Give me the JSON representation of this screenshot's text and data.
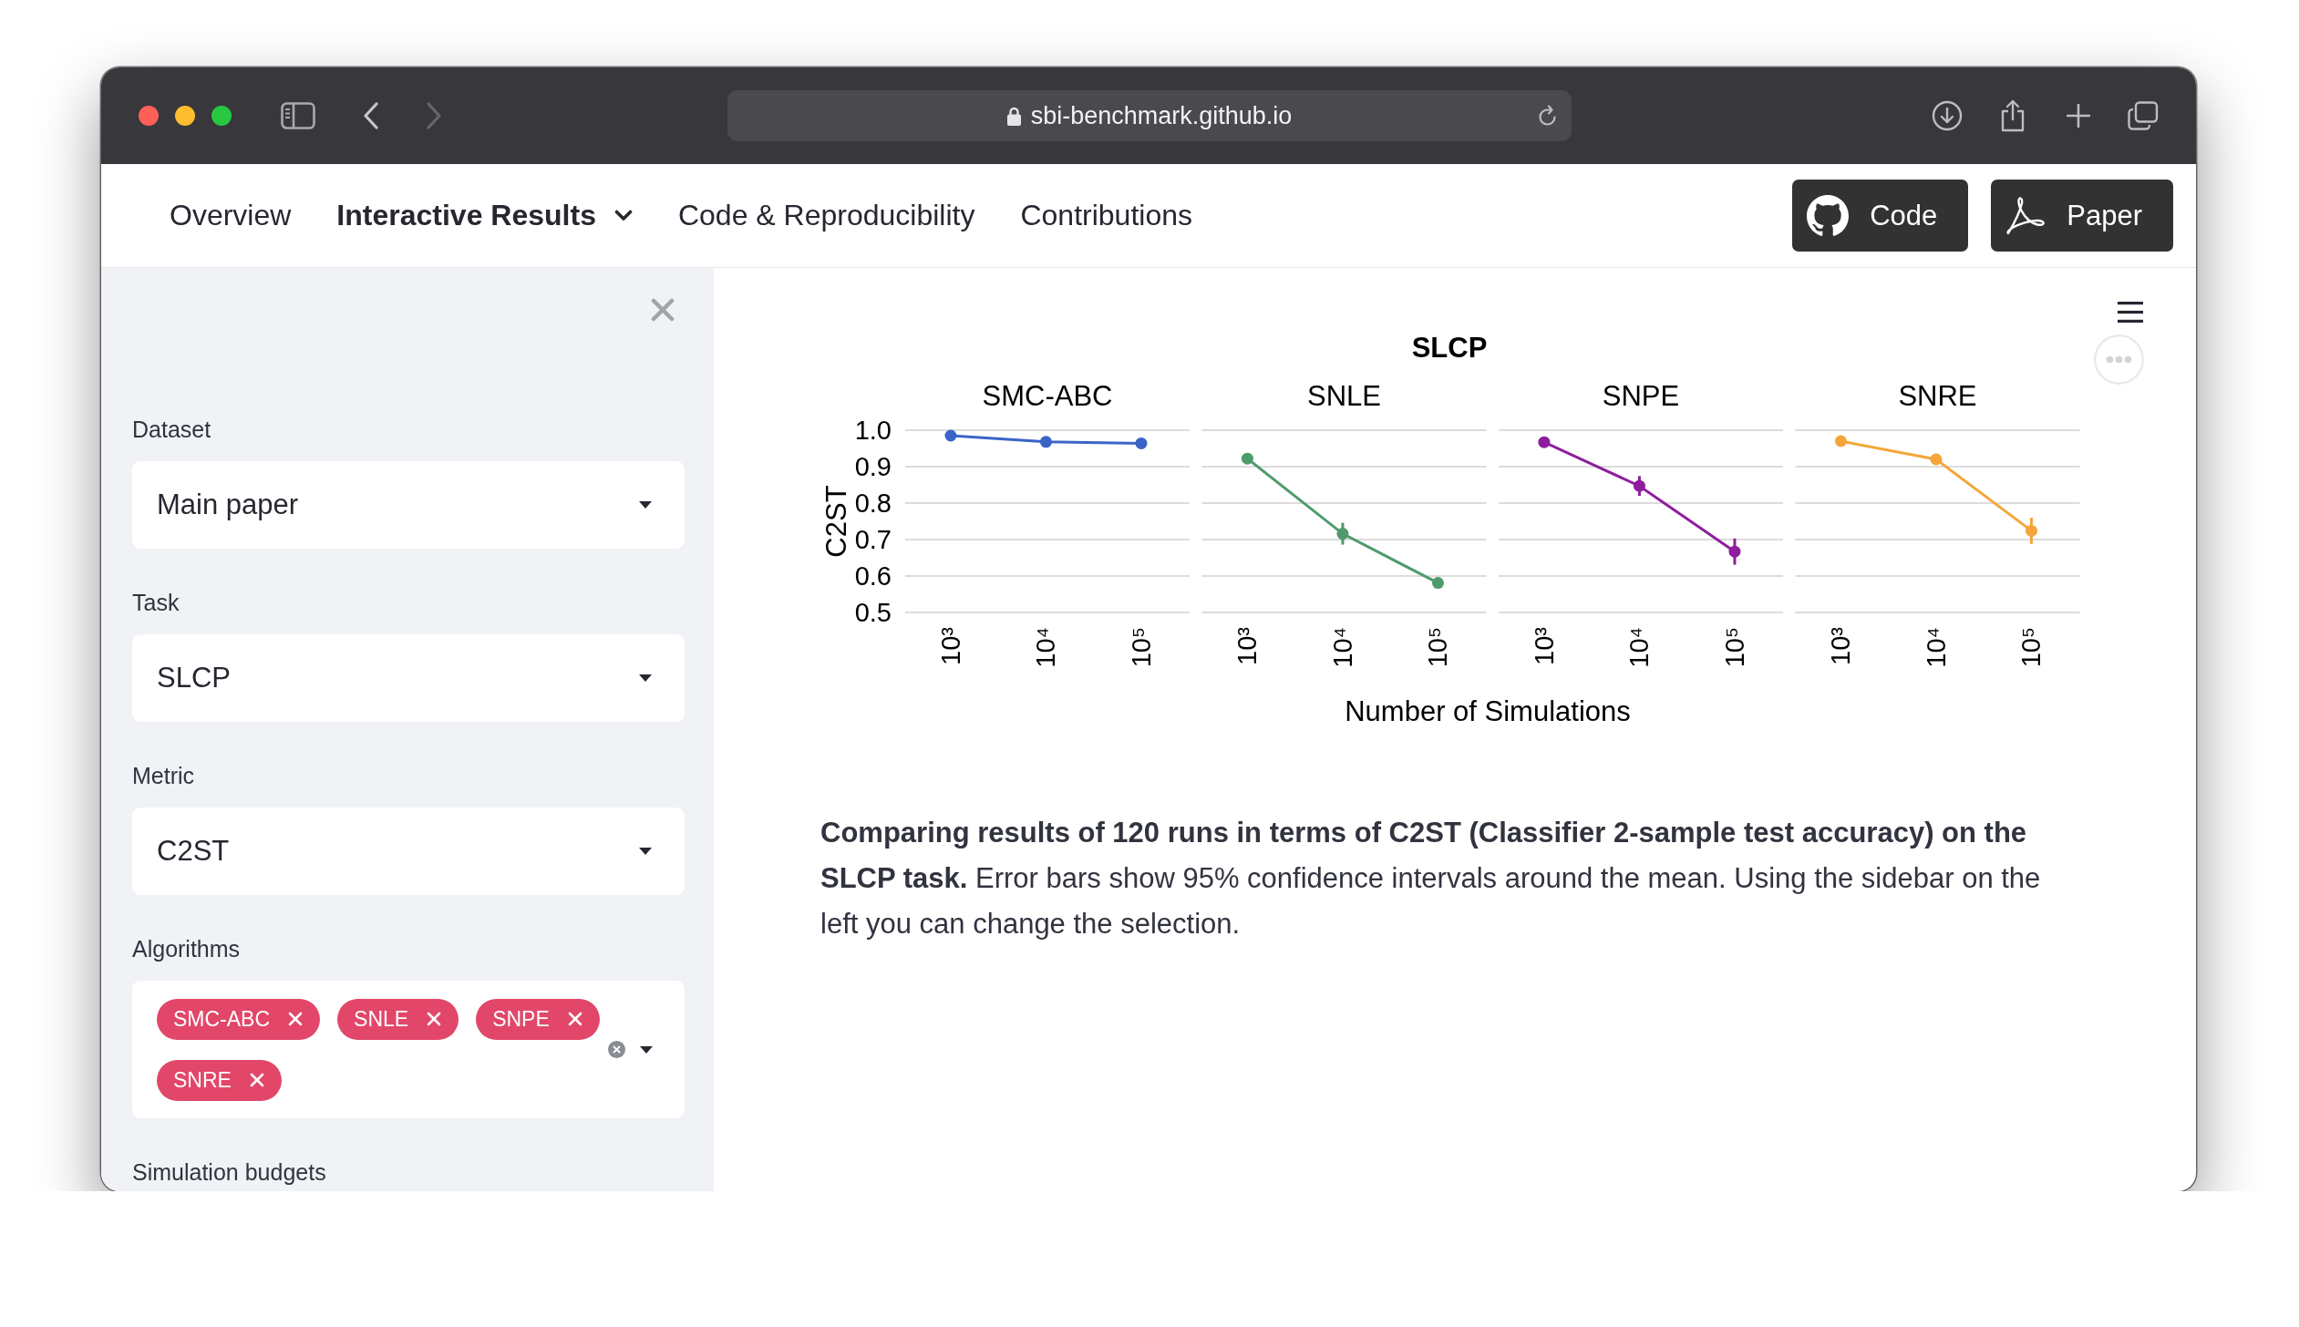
{
  "browser": {
    "url": "sbi-benchmark.github.io",
    "back_disabled": false,
    "forward_disabled": true
  },
  "nav": {
    "items": [
      {
        "label": "Overview",
        "kind": "link",
        "selected": false
      },
      {
        "label": "Interactive Results",
        "kind": "dropdown",
        "selected": true
      },
      {
        "label": "Code & Reproducibility",
        "kind": "link",
        "selected": false
      },
      {
        "label": "Contributions",
        "kind": "link",
        "selected": false
      }
    ],
    "buttons": [
      {
        "label": "Code",
        "kind": "github"
      },
      {
        "label": "Paper",
        "kind": "pdf"
      }
    ]
  },
  "sidebar": {
    "controls": [
      {
        "kind": "select",
        "label": "Dataset",
        "value": "Main paper"
      },
      {
        "kind": "select",
        "label": "Task",
        "value": "SLCP"
      },
      {
        "kind": "select",
        "label": "Metric",
        "value": "C2ST"
      },
      {
        "kind": "multiselect",
        "label": "Algorithms",
        "tags": [
          "SMC-ABC",
          "SNLE",
          "SNPE",
          "SNRE"
        ]
      },
      {
        "kind": "heading",
        "label": "Simulation budgets"
      }
    ]
  },
  "main": {
    "chart_data": {
      "type": "line",
      "title": "SLCP",
      "xlabel": "Number of Simulations",
      "ylabel": "C2ST",
      "categories": [
        "10³",
        "10⁴",
        "10⁵",
        "10³",
        "10⁴",
        "10⁵",
        "10³",
        "10⁴",
        "10⁵",
        "10³",
        "10⁴",
        "10⁵"
      ],
      "series": [
        {
          "name": "SMC-ABC",
          "color": "#3a64c8",
          "marker": "circle",
          "values": [
            0.985,
            0.968,
            0.964,
            null,
            null,
            null,
            null,
            null,
            null,
            null,
            null,
            null
          ]
        },
        {
          "name": "SNLE",
          "color": "#4f9a6b",
          "marker": "circle",
          "values": [
            null,
            null,
            null,
            0.922,
            0.716,
            0.581,
            null,
            null,
            null,
            null,
            null,
            null
          ],
          "errors": [
            null,
            null,
            null,
            null,
            0.03,
            null,
            null,
            null,
            null,
            null,
            null,
            null
          ]
        },
        {
          "name": "SNPE",
          "color": "#8e1e9c",
          "marker": "circle",
          "values": [
            null,
            null,
            null,
            null,
            null,
            null,
            0.967,
            0.847,
            0.667,
            null,
            null,
            null
          ],
          "errors": [
            null,
            null,
            null,
            null,
            null,
            null,
            null,
            0.027,
            0.036,
            null,
            null,
            null
          ]
        },
        {
          "name": "SNRE",
          "color": "#f4a63a",
          "marker": "circle",
          "values": [
            null,
            null,
            null,
            null,
            null,
            null,
            null,
            null,
            null,
            0.97,
            0.92,
            0.724
          ],
          "errors": [
            null,
            null,
            null,
            null,
            null,
            null,
            null,
            null,
            null,
            null,
            null,
            0.036
          ]
        }
      ],
      "ylim": [
        0.5,
        1
      ],
      "yticks": [
        0.5,
        0.6,
        0.7,
        0.8,
        0.9,
        {
          "value": 1,
          "label": "1.0"
        }
      ],
      "grid": true
    },
    "caption": "**Comparing results of 120 runs in terms of C2ST (Classifier 2-sample test accuracy) on the SLCP task.** Error bars show 95% confidence intervals around the mean. Using the sidebar on the left you can change the selection."
  }
}
